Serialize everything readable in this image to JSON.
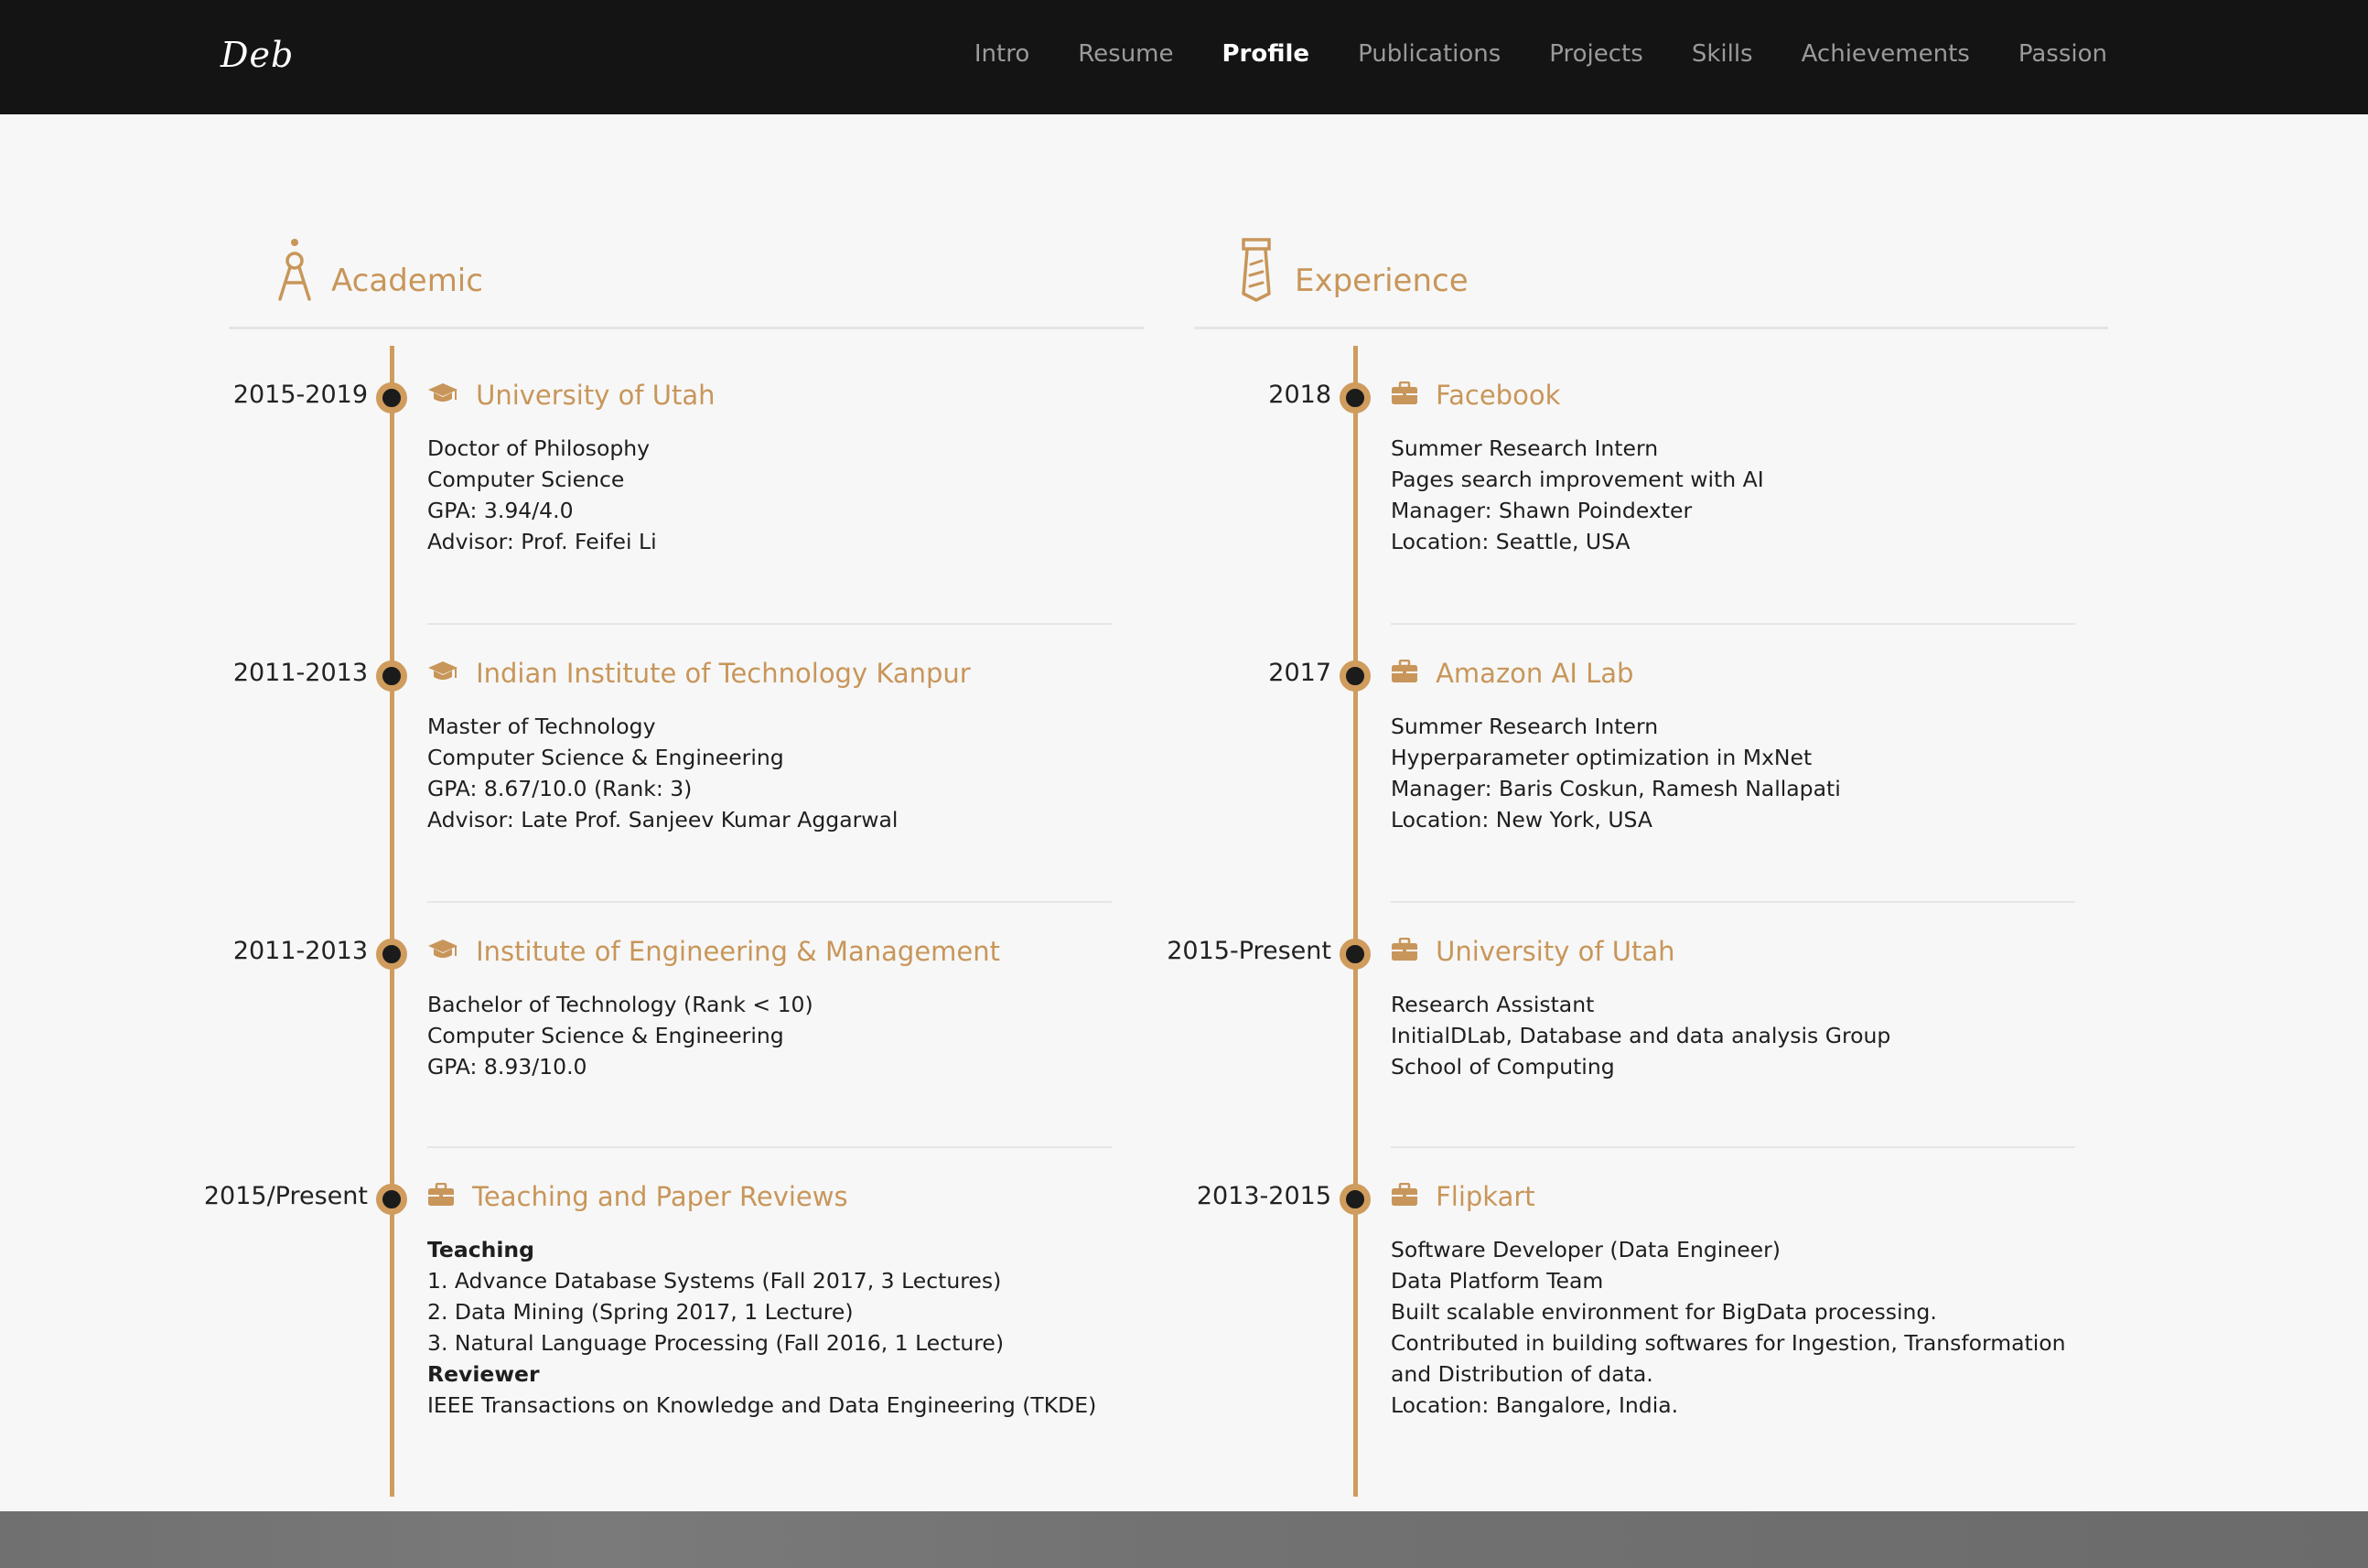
{
  "nav": {
    "brand": "Deb",
    "items": [
      "Intro",
      "Resume",
      "Profile",
      "Publications",
      "Projects",
      "Skills",
      "Achievements",
      "Passion"
    ],
    "active": "Profile"
  },
  "academic": {
    "title": "Academic",
    "icon": "compass-drafting-icon",
    "entries": [
      {
        "date": "2015-2019",
        "icon": "graduation-cap-icon",
        "title": "University of Utah",
        "lines": [
          "Doctor of Philosophy",
          "Computer Science",
          "GPA: 3.94/4.0",
          "Advisor: Prof. Feifei Li"
        ]
      },
      {
        "date": "2011-2013",
        "icon": "graduation-cap-icon",
        "title": "Indian Institute of Technology Kanpur",
        "lines": [
          "Master of Technology",
          "Computer Science & Engineering",
          "GPA: 8.67/10.0 (Rank: 3)",
          "Advisor: Late Prof. Sanjeev Kumar Aggarwal"
        ]
      },
      {
        "date": "2011-2013",
        "icon": "graduation-cap-icon",
        "title": "Institute of Engineering & Management",
        "lines": [
          "Bachelor of Technology (Rank < 10)",
          "Computer Science & Engineering",
          "GPA: 8.93/10.0"
        ]
      },
      {
        "date": "2015/Present",
        "icon": "briefcase-icon",
        "title": "Teaching and Paper Reviews",
        "lines": [
          "Teaching",
          "1. Advance Database Systems (Fall 2017, 3 Lectures)",
          "2. Data Mining (Spring 2017, 1 Lecture)",
          "3. Natural Language Processing (Fall 2016, 1 Lecture)",
          "Reviewer",
          "IEEE Transactions on Knowledge and Data Engineering (TKDE)"
        ]
      }
    ]
  },
  "experience": {
    "title": "Experience",
    "icon": "necktie-icon",
    "entries": [
      {
        "date": "2018",
        "icon": "briefcase-icon",
        "title": "Facebook",
        "lines": [
          "Summer Research Intern",
          "Pages search improvement with AI",
          "Manager: Shawn Poindexter",
          "Location: Seattle, USA"
        ]
      },
      {
        "date": "2017",
        "icon": "briefcase-icon",
        "title": "Amazon AI Lab",
        "lines": [
          "Summer Research Intern",
          "Hyperparameter optimization in MxNet",
          "Manager: Baris Coskun, Ramesh Nallapati",
          "Location: New York, USA"
        ]
      },
      {
        "date": "2015-Present",
        "icon": "briefcase-icon",
        "title": "University of Utah",
        "lines": [
          "Research Assistant",
          "InitialDLab, Database and data analysis Group",
          "School of Computing"
        ]
      },
      {
        "date": "2013-2015",
        "icon": "briefcase-icon",
        "title": "Flipkart",
        "lines": [
          "Software Developer (Data Engineer)",
          "Data Platform Team",
          "Built scalable environment for BigData processing.",
          "Contributed in building softwares for Ingestion, Transformation",
          "and Distribution of data.",
          "Location: Bangalore, India."
        ]
      }
    ]
  },
  "colors": {
    "accent": "#c8965a",
    "timeline": "#cf9c5d",
    "navbar": "#141414",
    "background": "#f7f7f7"
  }
}
